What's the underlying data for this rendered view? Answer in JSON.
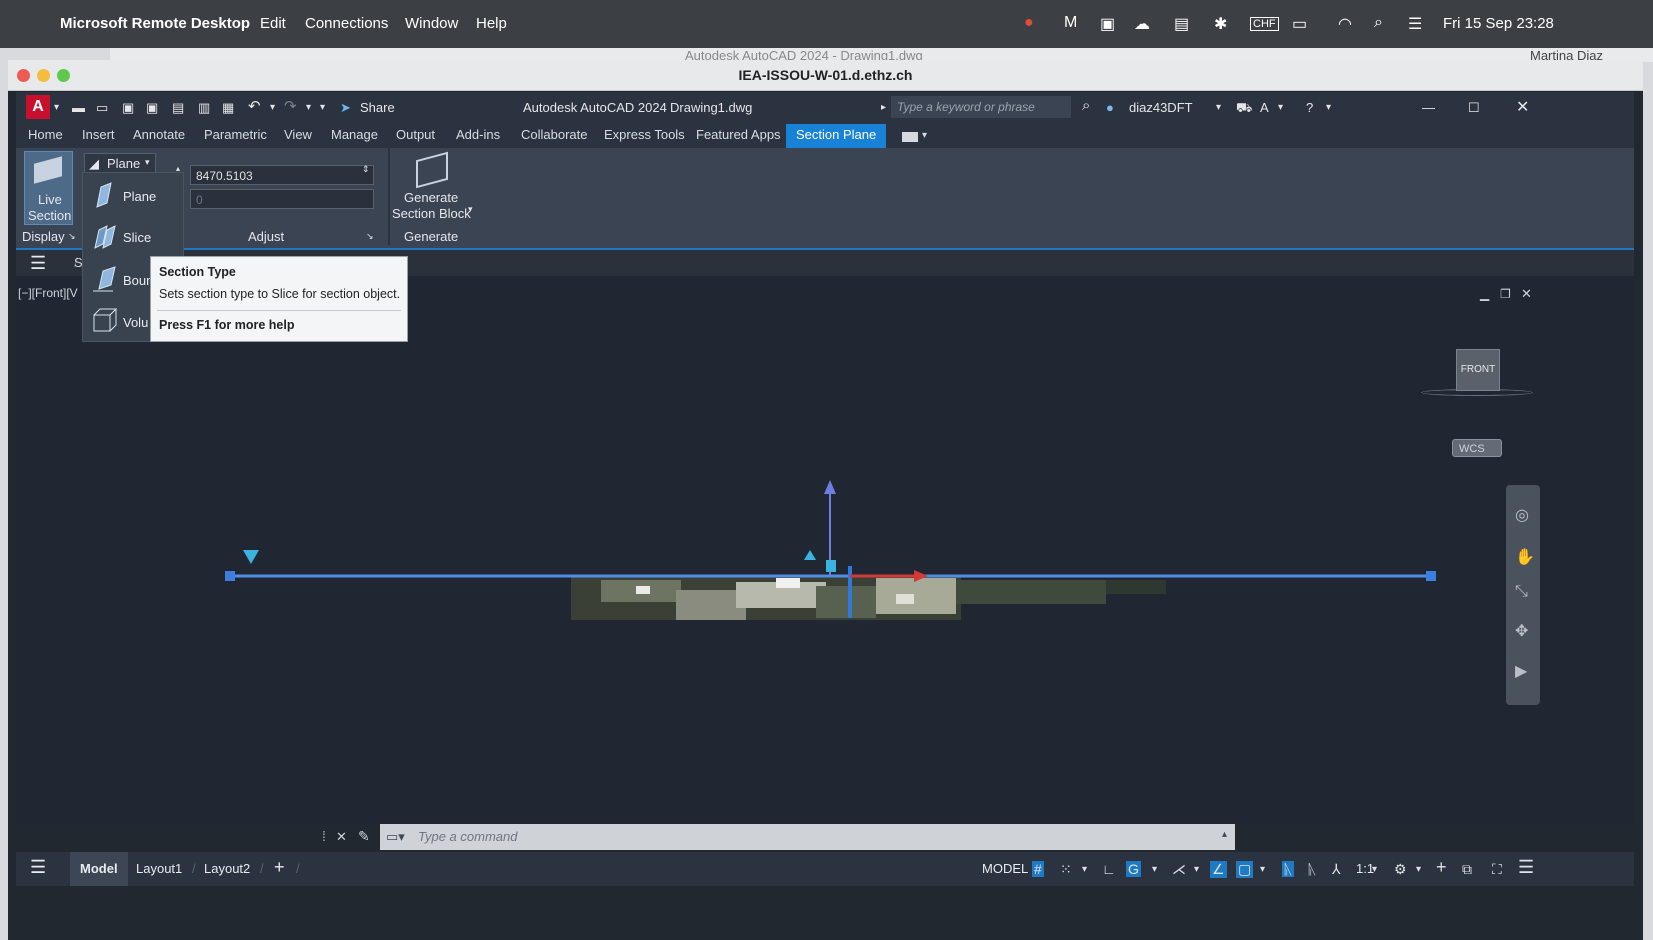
{
  "mac_menu": {
    "app": "Microsoft Remote Desktop",
    "items": [
      "Edit",
      "Connections",
      "Window",
      "Help"
    ],
    "datetime": "Fri 15 Sep  23:28"
  },
  "bg_window": {
    "title": "Autodesk AutoCAD 2024 - Drawing1.dwg",
    "user": "Martina Diaz"
  },
  "rdp_window": {
    "title": "IEA-ISSOU-W-01.d.ethz.ch"
  },
  "quick_access": {
    "share_label": "Share",
    "app_title": "Autodesk AutoCAD 2024",
    "document": "Drawing1.dwg",
    "search_placeholder": "Type a keyword or phrase",
    "user": "diaz43DFT"
  },
  "ribbon_tabs": [
    "Home",
    "Insert",
    "Annotate",
    "Parametric",
    "View",
    "Manage",
    "Output",
    "Add-ins",
    "Collaborate",
    "Express Tools",
    "Featured Apps",
    "Section Plane"
  ],
  "active_tab": "Section Plane",
  "ribbon": {
    "live_section_l1": "Live",
    "live_section_l2": "Section",
    "display_panel": "Display",
    "plane_dropdown": "Plane",
    "offset_value": "8470.5103",
    "second_value": "0",
    "adjust_panel": "Adjust",
    "generate_l1": "Generate",
    "generate_l2": "Section Block",
    "generate_panel": "Generate"
  },
  "dropdown_items": [
    "Plane",
    "Slice",
    "Boun",
    "Volu"
  ],
  "filebar_label": "S",
  "view_label": "[−][Front][V",
  "tooltip": {
    "title": "Section Type",
    "description": "Sets section type to Slice for section object.",
    "help": "Press F1 for more help"
  },
  "viewcube": {
    "face": "FRONT",
    "wcs": "WCS"
  },
  "command": {
    "placeholder": "Type  a  command"
  },
  "status": {
    "tabs": [
      "Model",
      "Layout1",
      "Layout2"
    ],
    "model_label": "MODEL",
    "scale": "1:1"
  }
}
